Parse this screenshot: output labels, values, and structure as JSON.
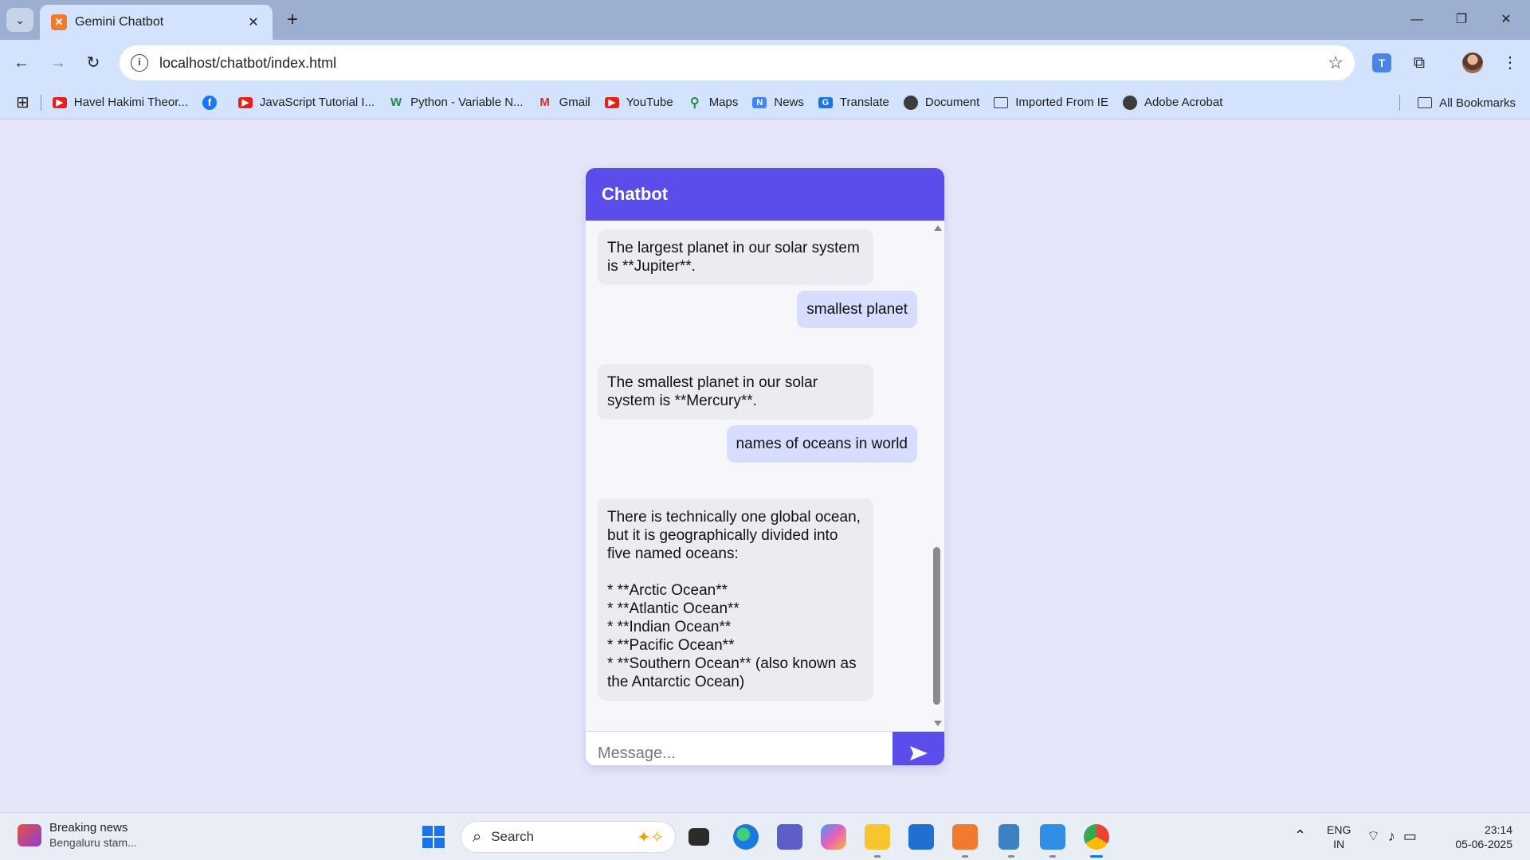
{
  "browser": {
    "tab": {
      "title": "Gemini Chatbot",
      "favicon": "xampp-icon"
    },
    "url": "localhost/chatbot/index.html",
    "bookmarks": [
      {
        "label": "Havel Hakimi Theor...",
        "icon": "youtube-icon"
      },
      {
        "label": "",
        "icon": "facebook-icon"
      },
      {
        "label": "JavaScript Tutorial I...",
        "icon": "youtube-icon"
      },
      {
        "label": "Python - Variable N...",
        "icon": "w3schools-icon"
      },
      {
        "label": "Gmail",
        "icon": "gmail-icon"
      },
      {
        "label": "YouTube",
        "icon": "youtube-icon"
      },
      {
        "label": "Maps",
        "icon": "maps-icon"
      },
      {
        "label": "News",
        "icon": "news-icon"
      },
      {
        "label": "Translate",
        "icon": "translate-icon"
      },
      {
        "label": "Document",
        "icon": "globe-icon"
      },
      {
        "label": "Imported From IE",
        "icon": "folder-icon"
      },
      {
        "label": "Adobe Acrobat",
        "icon": "globe-icon"
      }
    ],
    "all_bookmarks": "All Bookmarks"
  },
  "chat": {
    "title": "Chatbot",
    "messages": [
      {
        "role": "bot",
        "text": "The largest planet in our solar system is **Jupiter**."
      },
      {
        "role": "user",
        "text": "smallest planet"
      },
      {
        "role": "bot",
        "text": "The smallest planet in our solar system is **Mercury**."
      },
      {
        "role": "user",
        "text": "names of oceans in world"
      },
      {
        "role": "bot",
        "text": "There is technically one global ocean, but it is geographically divided into five named oceans:\n\n* **Arctic Ocean**\n* **Atlantic Ocean**\n* **Indian Ocean**\n* **Pacific Ocean**\n* **Southern Ocean** (also known as the Antarctic Ocean)"
      }
    ],
    "input_placeholder": "Message...",
    "input_value": "",
    "accent_color": "#5b4dea"
  },
  "taskbar": {
    "news_title": "Breaking news",
    "news_sub": "Bengaluru stam...",
    "search_label": "Search",
    "lang_top": "ENG",
    "lang_bottom": "IN",
    "time": "23:14",
    "date": "05-06-2025"
  }
}
